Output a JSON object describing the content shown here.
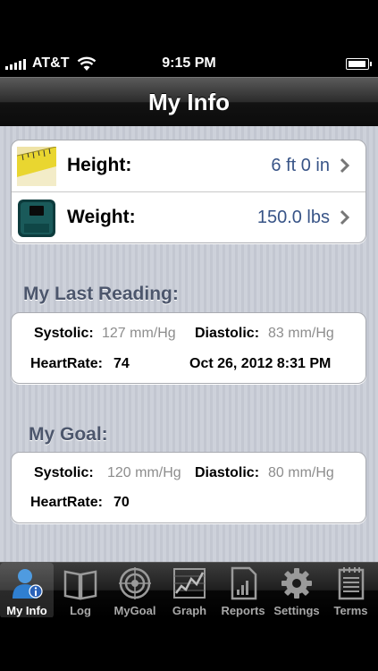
{
  "status_bar": {
    "carrier": "AT&T",
    "time": "9:15 PM"
  },
  "nav": {
    "title": "My Info"
  },
  "profile": {
    "height": {
      "label": "Height:",
      "value": "6 ft 0 in"
    },
    "weight": {
      "label": "Weight:",
      "value": "150.0 lbs"
    }
  },
  "last_reading": {
    "title": "My Last Reading:",
    "systolic_label": "Systolic:",
    "systolic_value": "127 mm/Hg",
    "diastolic_label": "Diastolic:",
    "diastolic_value": "83 mm/Hg",
    "heartrate_label": "HeartRate:",
    "heartrate_value": "74",
    "timestamp": "Oct 26, 2012 8:31 PM"
  },
  "goal": {
    "title": "My Goal:",
    "systolic_label": "Systolic:",
    "systolic_value": "120 mm/Hg",
    "diastolic_label": "Diastolic:",
    "diastolic_value": "80 mm/Hg",
    "heartrate_label": "HeartRate:",
    "heartrate_value": "70"
  },
  "tabs": [
    {
      "label": "My Info",
      "icon": "person-info-icon",
      "active": true
    },
    {
      "label": "Log",
      "icon": "book-icon"
    },
    {
      "label": "MyGoal",
      "icon": "target-icon"
    },
    {
      "label": "Graph",
      "icon": "graph-icon"
    },
    {
      "label": "Reports",
      "icon": "report-icon"
    },
    {
      "label": "Settings",
      "icon": "gear-icon"
    },
    {
      "label": "Terms",
      "icon": "notepad-icon"
    }
  ],
  "colors": {
    "value_blue": "#385487",
    "section_title": "#4c566c",
    "muted_value": "#8d8d8d"
  }
}
